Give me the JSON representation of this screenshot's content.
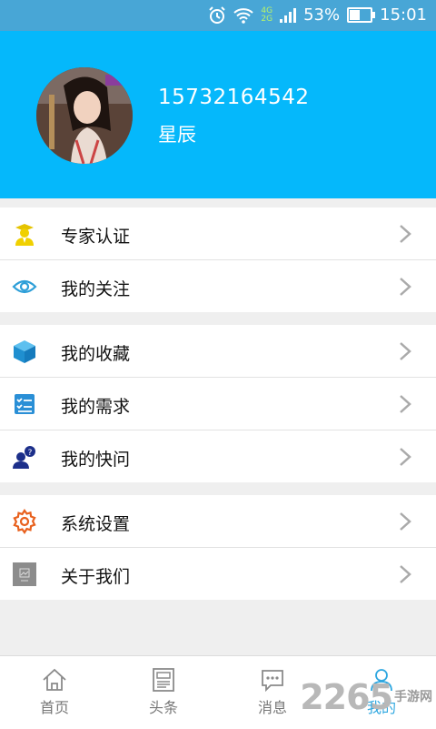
{
  "status_bar": {
    "network_top": "4G",
    "network_bottom": "2G",
    "battery_percent": "53%",
    "battery_level": 0.53,
    "time": "15:01",
    "icons": [
      "alarm-icon",
      "wifi-icon",
      "signal-icon",
      "battery-icon"
    ]
  },
  "profile": {
    "phone": "15732164542",
    "nickname": "星辰"
  },
  "menu": {
    "groups": [
      {
        "items": [
          {
            "label": "专家认证",
            "icon": "expert-badge-icon"
          },
          {
            "label": "我的关注",
            "icon": "eye-icon"
          }
        ]
      },
      {
        "items": [
          {
            "label": "我的收藏",
            "icon": "cube-icon"
          },
          {
            "label": "我的需求",
            "icon": "checklist-icon"
          },
          {
            "label": "我的快问",
            "icon": "user-question-icon"
          }
        ]
      },
      {
        "items": [
          {
            "label": "系统设置",
            "icon": "gear-icon"
          },
          {
            "label": "关于我们",
            "icon": "about-image-icon"
          }
        ]
      }
    ]
  },
  "tabbar": {
    "tabs": [
      {
        "label": "首页",
        "icon": "home-icon"
      },
      {
        "label": "头条",
        "icon": "newspaper-icon"
      },
      {
        "label": "消息",
        "icon": "message-icon"
      },
      {
        "label": "我的",
        "icon": "profile-icon"
      }
    ],
    "active_color": "#2ea7e0"
  },
  "watermark": {
    "number": "2265",
    "text": "手游网"
  },
  "colors": {
    "header": "#05b8fb",
    "statusbar": "#48a6d6",
    "background": "#efefef"
  }
}
